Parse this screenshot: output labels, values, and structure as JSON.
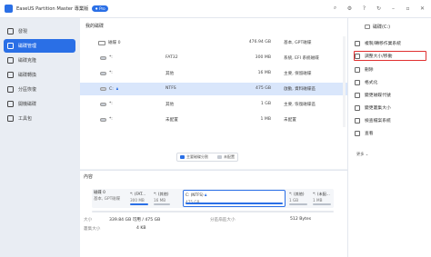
{
  "titlebar": {
    "app_title": "EaseUS Partition Master 專業版",
    "pro_badge": "Pro",
    "icons": [
      "search-icon",
      "gear-icon",
      "help-icon",
      "refresh-icon",
      "minimize-icon",
      "maximize-icon",
      "close-icon"
    ]
  },
  "sidebar": {
    "items": [
      {
        "label": "發現",
        "icon": "discover-icon",
        "active": false
      },
      {
        "label": "磁碟管理",
        "icon": "disk-manager-icon",
        "active": true
      },
      {
        "label": "磁碟克隆",
        "icon": "clone-icon",
        "active": false
      },
      {
        "label": "磁碟轉換",
        "icon": "convert-icon",
        "active": false
      },
      {
        "label": "分區恢復",
        "icon": "recovery-icon",
        "active": false
      },
      {
        "label": "開機磁碟",
        "icon": "bootable-icon",
        "active": false
      },
      {
        "label": "工具包",
        "icon": "toolkit-icon",
        "active": false
      }
    ]
  },
  "main": {
    "section_title": "我的磁碟",
    "rows": [
      {
        "name": "磁碟 0",
        "type": "disk",
        "fs": "",
        "size": "476.94 GB",
        "info": "基本, GPT磁碟"
      },
      {
        "name": "*:",
        "type": "part",
        "fs": "FAT32",
        "size": "300 MB",
        "info": "系統, EFI 系統磁碟"
      },
      {
        "name": "*:",
        "type": "part",
        "fs": "其他",
        "size": "16 MB",
        "info": "主要, 保留磁碟"
      },
      {
        "name": "C:",
        "type": "part",
        "fs": "NTFS",
        "size": "475 GB",
        "info": "啟動, 資料磁碟區",
        "selected": true,
        "locked": true
      },
      {
        "name": "*:",
        "type": "part",
        "fs": "其他",
        "size": "1 GB",
        "info": "主要, 恢復磁碟區"
      },
      {
        "name": "*:",
        "type": "part",
        "fs": "未配置",
        "size": "1 MB",
        "info": "未配置"
      }
    ],
    "legend": [
      {
        "label": "主要磁碟分割",
        "color": "#2a6fe6"
      },
      {
        "label": "未配置",
        "color": "#c5cad2"
      }
    ]
  },
  "actions": {
    "title": "磁碟(C:)",
    "items": [
      {
        "label": "複製/轉移作業系統",
        "icon": "migrate-icon"
      },
      {
        "label": "調整大小/移動",
        "icon": "resize-icon",
        "highlighted": true
      },
      {
        "label": "刪除",
        "icon": "delete-icon"
      },
      {
        "label": "格式化",
        "icon": "format-icon"
      },
      {
        "label": "變更磁碟代號",
        "icon": "drive-letter-icon"
      },
      {
        "label": "變更叢集大小",
        "icon": "cluster-size-icon"
      },
      {
        "label": "檢查檔案系統",
        "icon": "check-icon"
      },
      {
        "label": "查看",
        "icon": "view-icon"
      }
    ],
    "more": "更多"
  },
  "content": {
    "title": "內容",
    "disk_label": "磁碟 0",
    "disk_sub": "基本, GPT磁碟",
    "disk_size": "476.94 GB",
    "segments": [
      {
        "label": "*: (FAT...",
        "size": "300 MB"
      },
      {
        "label": "*: (其他)",
        "size": "16 MB"
      },
      {
        "label": "C: (NTFS)",
        "size": "475 GB",
        "selected": true
      },
      {
        "label": "*: (其他)",
        "size": "1 GB"
      },
      {
        "label": "*: (未配...",
        "size": "1 MB"
      }
    ],
    "details": {
      "size_label": "大小",
      "size_value": "339.84 GB 可用 / 475 GB",
      "cluster_label": "叢集大小",
      "cluster_value": "4 KB",
      "sector_label": "分區扇區大小",
      "sector_value": "512 Bytes"
    }
  }
}
